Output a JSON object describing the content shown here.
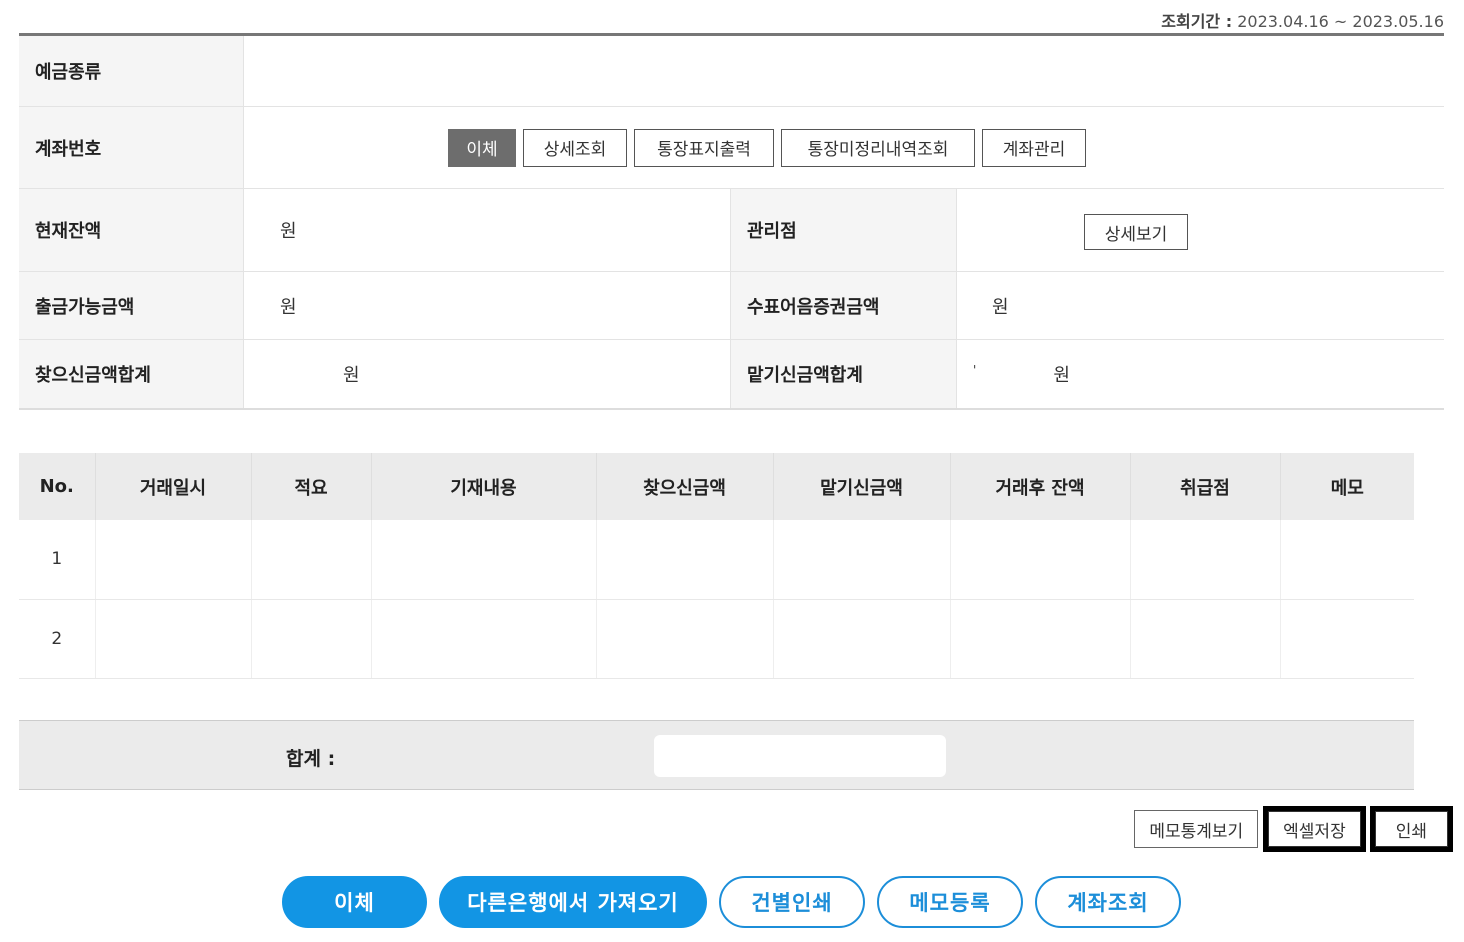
{
  "period": {
    "label": "조회기간 :",
    "value": "2023.04.16 ~ 2023.05.16"
  },
  "info": {
    "deposit_type_label": "예금종류",
    "account_no_label": "계좌번호",
    "account_buttons": [
      "이체",
      "상세조회",
      "통장표지출력",
      "통장미정리내역조회",
      "계좌관리"
    ],
    "balance_label": "현재잔액",
    "balance_unit": "원",
    "branch_label": "관리점",
    "branch_button": "상세보기",
    "available_label": "출금가능금액",
    "available_unit": "원",
    "check_label": "수표어음증권금액",
    "check_unit": "원",
    "withdraw_total_label": "찾으신금액합계",
    "withdraw_total_unit": "원",
    "deposit_total_label": "맡기신금액합계",
    "deposit_total_mark": "'",
    "deposit_total_unit": "원"
  },
  "table": {
    "headers": [
      "No.",
      "거래일시",
      "적요",
      "기재내용",
      "찾으신금액",
      "맡기신금액",
      "거래후 잔액",
      "취급점",
      "메모"
    ],
    "rows": [
      {
        "no": "1"
      },
      {
        "no": "2"
      }
    ]
  },
  "total": {
    "label": "합계 :"
  },
  "small_buttons": {
    "memo_stats": "메모통계보기",
    "excel": "엑셀저장",
    "print": "인쇄"
  },
  "bottom_buttons": {
    "transfer": "이체",
    "import": "다른은행에서 가져오기",
    "print_each": "건별인쇄",
    "memo_register": "메모등록",
    "account_inquiry": "계좌조회"
  },
  "colors": {
    "primary": "#1295e4",
    "header_bg": "#ebebeb",
    "label_bg": "#f5f5f5"
  }
}
